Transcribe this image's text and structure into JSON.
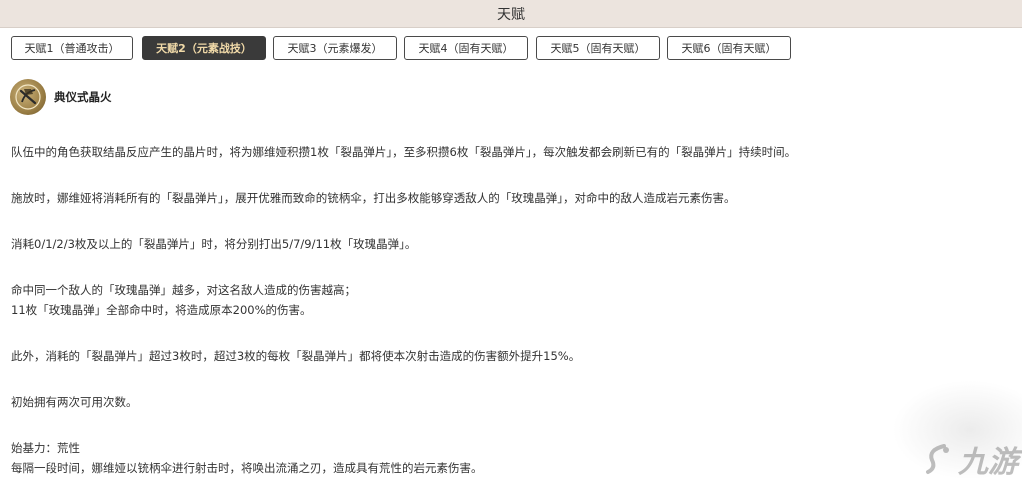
{
  "header": {
    "title": "天赋"
  },
  "tabs": [
    {
      "label": "天赋1（普通攻击）",
      "active": false
    },
    {
      "label": "天赋2（元素战技）",
      "active": true
    },
    {
      "label": "天赋3（元素爆发）",
      "active": false
    },
    {
      "label": "天赋4（固有天赋）",
      "active": false
    },
    {
      "label": "天赋5（固有天赋）",
      "active": false
    },
    {
      "label": "天赋6（固有天赋）",
      "active": false
    }
  ],
  "skill": {
    "icon": "parasol-skill-icon",
    "name": "典仪式晶火"
  },
  "content": {
    "p1": "队伍中的角色获取结晶反应产生的晶片时，将为娜维娅积攒1枚「裂晶弹片」，至多积攒6枚「裂晶弹片」，每次触发都会刷新已有的「裂晶弹片」持续时间。",
    "p2": "施放时，娜维娅将消耗所有的「裂晶弹片」，展开优雅而致命的铳柄伞，打出多枚能够穿透敌人的「玫瑰晶弹」，对命中的敌人造成岩元素伤害。",
    "p3": "消耗0/1/2/3枚及以上的「裂晶弹片」时，将分别打出5/7/9/11枚「玫瑰晶弹」。",
    "p4a": "命中同一个敌人的「玫瑰晶弹」越多，对这名敌人造成的伤害越高；",
    "p4b": "11枚「玫瑰晶弹」全部命中时，将造成原本200%的伤害。",
    "p5": "此外，消耗的「裂晶弹片」超过3枚时，超过3枚的每枚「裂晶弹片」都将使本次射击造成的伤害额外提升15%。",
    "p6": "初始拥有两次可用次数。",
    "p7a": "始基力：荒性",
    "p7b": "每隔一段时间，娜维娅以铳柄伞进行射击时，将唤出流涌之刃，造成具有荒性的岩元素伤害。"
  },
  "watermark": {
    "text": "九游"
  }
}
